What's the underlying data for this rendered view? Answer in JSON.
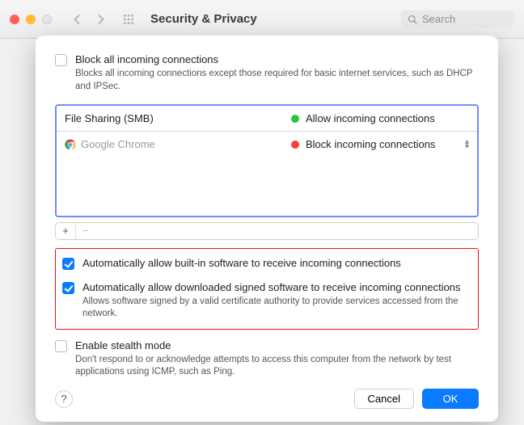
{
  "toolbar": {
    "title": "Security & Privacy",
    "search_placeholder": "Search"
  },
  "block_all": {
    "label": "Block all incoming connections",
    "desc": "Blocks all incoming connections except those required for basic internet services, such as DHCP and IPSec.",
    "checked": false
  },
  "apps": [
    {
      "name": "File Sharing (SMB)",
      "status_label": "Allow incoming connections",
      "status": "allow",
      "dimmed": false,
      "icon": "none"
    },
    {
      "name": "Google Chrome",
      "status_label": "Block incoming connections",
      "status": "block",
      "dimmed": true,
      "icon": "chrome"
    }
  ],
  "auto_builtin": {
    "label": "Automatically allow built-in software to receive incoming connections",
    "checked": true
  },
  "auto_signed": {
    "label": "Automatically allow downloaded signed software to receive incoming connections",
    "desc": "Allows software signed by a valid certificate authority to provide services accessed from the network.",
    "checked": true
  },
  "stealth": {
    "label": "Enable stealth mode",
    "desc": "Don't respond to or acknowledge attempts to access this computer from the network by test applications using ICMP, such as Ping.",
    "checked": false
  },
  "buttons": {
    "cancel": "Cancel",
    "ok": "OK"
  }
}
